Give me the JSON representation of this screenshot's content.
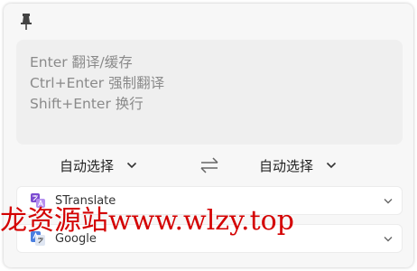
{
  "input": {
    "placeholder_lines": [
      "Enter 翻译/缓存",
      "Ctrl+Enter 强制翻译",
      "Shift+Enter 换行"
    ]
  },
  "languages": {
    "source": "自动选择",
    "target": "自动选择"
  },
  "services": [
    {
      "name": "STranslate",
      "icon": "stranslate-logo-icon"
    },
    {
      "name": "Google",
      "icon": "google-translate-icon"
    }
  ],
  "watermark": {
    "text": "龙资源站www.wlzy.top"
  },
  "colors": {
    "background": "#f7f7f7",
    "input_background": "#efefef",
    "placeholder": "#8a8a8a",
    "watermark": "#d40000",
    "stranslate_purple": "#7b4bd1",
    "google_blue": "#4a7fe0"
  }
}
